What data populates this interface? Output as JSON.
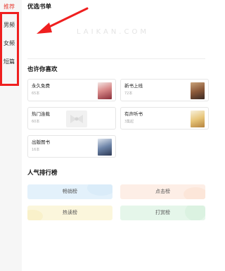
{
  "sidebar": {
    "items": [
      {
        "label": "推荐"
      },
      {
        "label": "男频"
      },
      {
        "label": "女频"
      },
      {
        "label": "短篇"
      }
    ]
  },
  "featured": {
    "title": "优选书单",
    "watermark": "LAIKAN.COM"
  },
  "recommend": {
    "title": "也许你喜欢",
    "cards": [
      {
        "title": "永久免费",
        "count": "65本",
        "cover_icon": "book-cover-icon"
      },
      {
        "title": "新书上线",
        "count": "72本",
        "cover_icon": "book-cover-icon"
      },
      {
        "title": "热门连载",
        "count": "60本",
        "cover_icon": "book-cover-icon"
      },
      {
        "title": "有声听书",
        "count": "3集起",
        "cover_icon": "book-cover-icon"
      },
      {
        "title": "出版图书",
        "count": "16本",
        "cover_icon": "book-cover-icon"
      }
    ]
  },
  "ranking": {
    "title": "人气排行榜",
    "lists": [
      {
        "label": "畅销榜",
        "color": "#e3f1fb"
      },
      {
        "label": "点击榜",
        "color": "#fdeee6"
      },
      {
        "label": "热读榜",
        "color": "#fbf6dc"
      },
      {
        "label": "打赏榜",
        "color": "#e5f6ea"
      }
    ]
  },
  "annotation": {
    "color": "#ef1f1f"
  }
}
